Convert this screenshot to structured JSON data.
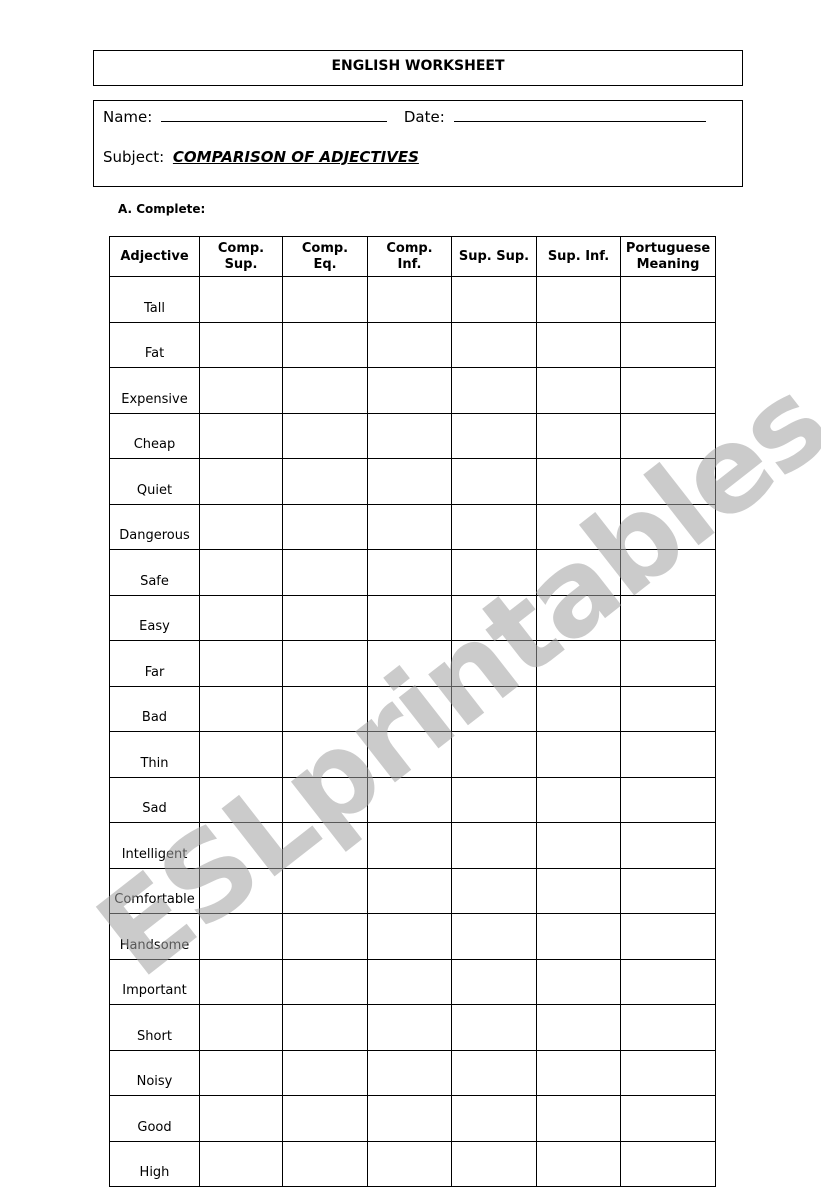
{
  "header": {
    "title": "ENGLISH WORKSHEET"
  },
  "info": {
    "name_label": "Name:",
    "date_label": "Date:",
    "subject_label": "Subject:",
    "subject_value": "COMPARISON OF ADJECTIVES"
  },
  "section": {
    "label": "A. Complete:"
  },
  "table": {
    "headers": [
      [
        "Adjective"
      ],
      [
        "Comp.",
        "Sup."
      ],
      [
        "Comp.",
        "Eq."
      ],
      [
        "Comp.",
        "Inf."
      ],
      [
        "Sup. Sup."
      ],
      [
        "Sup. Inf."
      ],
      [
        "Portuguese",
        "Meaning"
      ]
    ],
    "rows": [
      "Tall",
      "Fat",
      "Expensive",
      "Cheap",
      "Quiet",
      "Dangerous",
      "Safe",
      "Easy",
      "Far",
      "Bad",
      "Thin",
      "Sad",
      "Intelligent",
      "Comfortable",
      "Handsome",
      "Important",
      "Short",
      "Noisy",
      "Good",
      "High"
    ]
  },
  "watermark": {
    "text": "ESLprintables.com"
  }
}
